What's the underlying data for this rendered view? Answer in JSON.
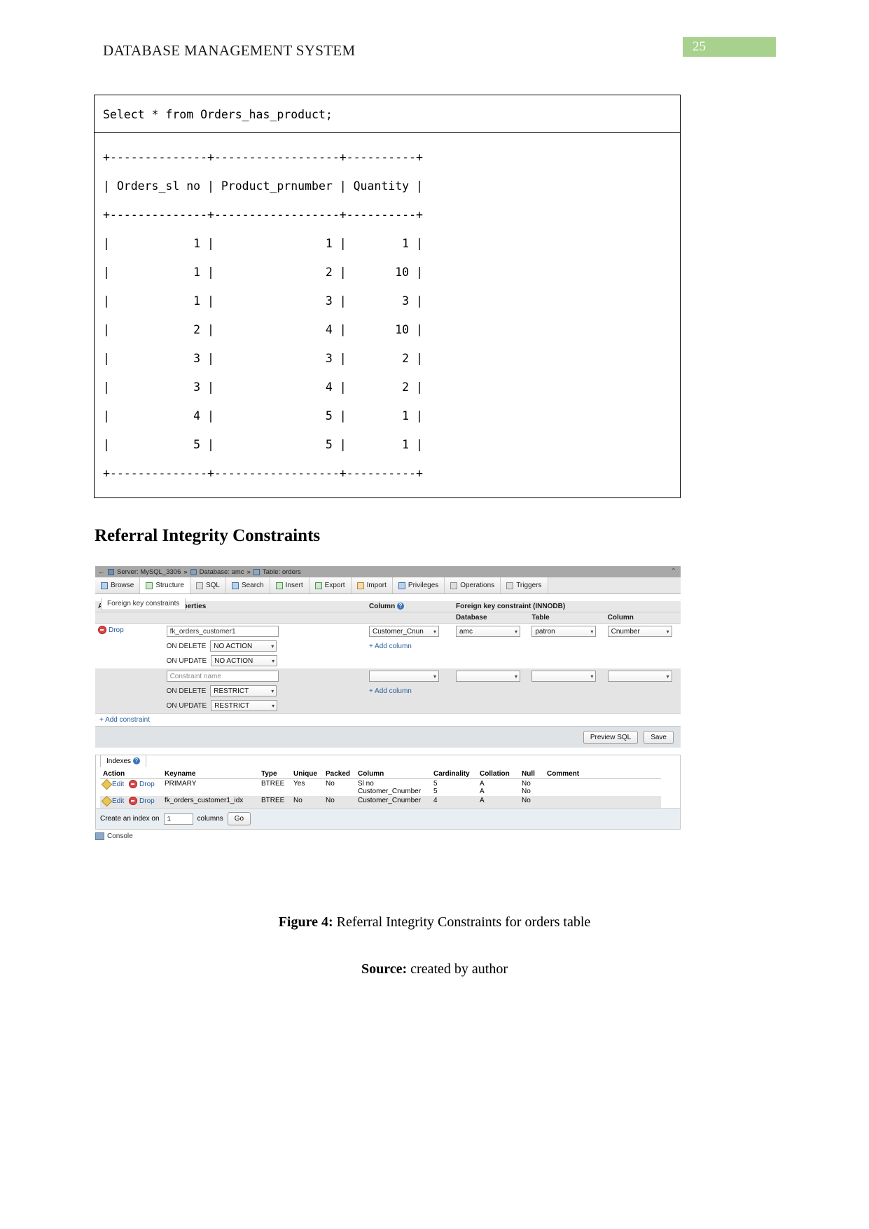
{
  "header": {
    "title": "DATABASE MANAGEMENT SYSTEM",
    "page_number": "25",
    "badge_color": "#a9d18e"
  },
  "sql_block": {
    "query": "Select * from Orders_has_product;",
    "separator": "+--------------+------------------+----------+",
    "header_row": "| Orders_sl no | Product_prnumber | Quantity |",
    "rows": [
      "|            1 |                1 |        1 |",
      "|            1 |                2 |       10 |",
      "|            1 |                3 |        3 |",
      "|            2 |                4 |       10 |",
      "|            3 |                3 |        2 |",
      "|            3 |                4 |        2 |",
      "|            4 |                5 |        1 |",
      "|            5 |                5 |        1 |"
    ],
    "table_data": {
      "columns": [
        "Orders_sl no",
        "Product_prnumber",
        "Quantity"
      ],
      "values": [
        [
          1,
          1,
          1
        ],
        [
          1,
          2,
          10
        ],
        [
          1,
          3,
          3
        ],
        [
          2,
          4,
          10
        ],
        [
          3,
          3,
          2
        ],
        [
          3,
          4,
          2
        ],
        [
          4,
          5,
          1
        ],
        [
          5,
          5,
          1
        ]
      ]
    }
  },
  "section": {
    "heading": "Referral Integrity Constraints"
  },
  "phpmyadmin": {
    "breadcrumb": {
      "back_arrow": "←",
      "server": "Server: MySQL_3306",
      "sep1": "»",
      "database": "Database: amc",
      "sep2": "»",
      "table": "Table: orders",
      "collapse": "⌃"
    },
    "tabs": [
      {
        "label": "Browse",
        "icon": "browse-icon",
        "active": false
      },
      {
        "label": "Structure",
        "icon": "structure-icon",
        "active": true
      },
      {
        "label": "SQL",
        "icon": "sql-icon",
        "active": false
      },
      {
        "label": "Search",
        "icon": "search-icon",
        "active": false
      },
      {
        "label": "Insert",
        "icon": "insert-icon",
        "active": false
      },
      {
        "label": "Export",
        "icon": "export-icon",
        "active": false
      },
      {
        "label": "Import",
        "icon": "import-icon",
        "active": false
      },
      {
        "label": "Privileges",
        "icon": "privileges-icon",
        "active": false
      },
      {
        "label": "Operations",
        "icon": "operations-icon",
        "active": false
      },
      {
        "label": "Triggers",
        "icon": "triggers-icon",
        "active": false
      }
    ],
    "subtab_label": "Foreign key constraints",
    "fk_table": {
      "headers": {
        "actions": "Actions",
        "constraint_properties": "Constraint properties",
        "column": "Column",
        "fk_constraint": "Foreign key constraint (INNODB)",
        "database": "Database",
        "table": "Table",
        "target_column": "Column"
      },
      "rows": [
        {
          "action_label": "Drop",
          "constraint_name": "fk_orders_customer1",
          "constraint_name_placeholder": "Constraint name",
          "on_delete_label": "ON DELETE",
          "on_delete_value": "NO ACTION",
          "on_update_label": "ON UPDATE",
          "on_update_value": "NO ACTION",
          "column_value": "Customer_Cnun",
          "add_column": "+ Add column",
          "database_value": "amc",
          "table_value": "patron",
          "target_column_value": "Cnumber"
        },
        {
          "action_label": "",
          "constraint_name": "",
          "constraint_name_placeholder": "Constraint name",
          "on_delete_label": "ON DELETE",
          "on_delete_value": "RESTRICT",
          "on_update_label": "ON UPDATE",
          "on_update_value": "RESTRICT",
          "column_value": "",
          "add_column": "+ Add column",
          "database_value": "",
          "table_value": "",
          "target_column_value": ""
        }
      ],
      "add_constraint": "+ Add constraint",
      "preview_sql_button": "Preview SQL",
      "save_button": "Save"
    },
    "indexes": {
      "panel_label": "Indexes",
      "headers": [
        "Action",
        "Keyname",
        "Type",
        "Unique",
        "Packed",
        "Column",
        "Cardinality",
        "Collation",
        "Null",
        "Comment"
      ],
      "rows": [
        {
          "edit": "Edit",
          "drop": "Drop",
          "keyname": "PRIMARY",
          "type": "BTREE",
          "unique": "Yes",
          "packed": "No",
          "columns": [
            "Sl no",
            "Customer_Cnumber"
          ],
          "cardinalities": [
            "5",
            "5"
          ],
          "collations": [
            "A",
            "A"
          ],
          "nulls": [
            "No",
            "No"
          ],
          "comment": ""
        },
        {
          "edit": "Edit",
          "drop": "Drop",
          "keyname": "fk_orders_customer1_idx",
          "type": "BTREE",
          "unique": "No",
          "packed": "No",
          "columns": [
            "Customer_Cnumber"
          ],
          "cardinalities": [
            "4"
          ],
          "collations": [
            "A"
          ],
          "nulls": [
            "No"
          ],
          "comment": ""
        }
      ],
      "create_label": "Create an index on",
      "create_value": "1",
      "create_columns_label": "columns",
      "go_button": "Go"
    },
    "console_label": "Console"
  },
  "captions": {
    "figure_bold": "Figure 4:",
    "figure_text": " Referral Integrity Constraints for orders table",
    "source_bold": "Source:",
    "source_text": " created by author"
  }
}
